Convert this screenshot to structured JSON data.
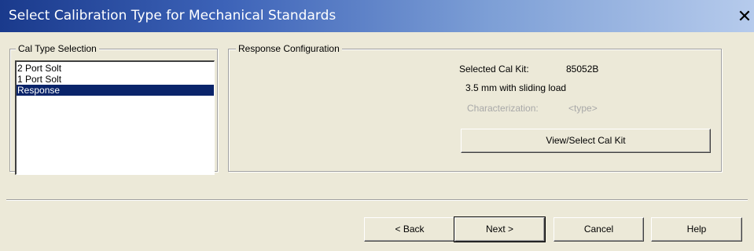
{
  "window": {
    "title": "Select Calibration Type for Mechanical Standards",
    "close_glyph": "✕"
  },
  "cal_type": {
    "label": "Cal Type Selection",
    "items": [
      {
        "label": "2 Port Solt",
        "selected": false
      },
      {
        "label": "1 Port Solt",
        "selected": false
      },
      {
        "label": "Response",
        "selected": true
      }
    ]
  },
  "response": {
    "label": "Response Configuration",
    "selected_kit_label": "Selected Cal Kit:",
    "selected_kit_value": "85052B",
    "kit_description": "3.5 mm with sliding load",
    "characterization_label": "Characterization:",
    "characterization_value": "<type>",
    "view_select_button": "View/Select Cal Kit"
  },
  "footer": {
    "back": "< Back",
    "next": "Next >",
    "cancel": "Cancel",
    "help": "Help"
  },
  "colors": {
    "title_gradient_start": "#1a3a8c",
    "title_gradient_end": "#b6cbec",
    "selection": "#0a246a",
    "dialog_bg": "#ece9d8"
  }
}
